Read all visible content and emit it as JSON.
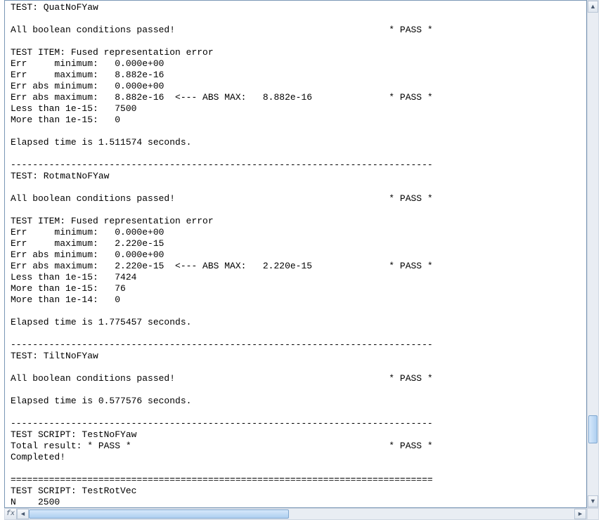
{
  "tests": [
    {
      "name": "QuatNoFYaw",
      "boolean_pass_msg": "All boolean conditions passed!",
      "boolean_pass_tag": "* PASS *",
      "item": {
        "title": "Fused representation error",
        "metrics": [
          {
            "label": "Err     minimum:",
            "value": "0.000e+00"
          },
          {
            "label": "Err     maximum:",
            "value": "8.882e-16"
          },
          {
            "label": "Err abs minimum:",
            "value": "0.000e+00"
          },
          {
            "label": "Err abs maximum:",
            "value": "8.882e-16",
            "absmax_val": "8.882e-16",
            "pass_tag": "* PASS *"
          },
          {
            "label": "Less than 1e-15:",
            "value": "7500"
          },
          {
            "label": "More than 1e-15:",
            "value": "0"
          }
        ]
      },
      "elapsed": "Elapsed time is 1.511574 seconds."
    },
    {
      "name": "RotmatNoFYaw",
      "boolean_pass_msg": "All boolean conditions passed!",
      "boolean_pass_tag": "* PASS *",
      "item": {
        "title": "Fused representation error",
        "metrics": [
          {
            "label": "Err     minimum:",
            "value": "0.000e+00"
          },
          {
            "label": "Err     maximum:",
            "value": "2.220e-15"
          },
          {
            "label": "Err abs minimum:",
            "value": "0.000e+00"
          },
          {
            "label": "Err abs maximum:",
            "value": "2.220e-15",
            "absmax_val": "2.220e-15",
            "pass_tag": "* PASS *"
          },
          {
            "label": "Less than 1e-15:",
            "value": "7424"
          },
          {
            "label": "More than 1e-15:",
            "value": "76"
          },
          {
            "label": "More than 1e-14:",
            "value": "0"
          }
        ]
      },
      "elapsed": "Elapsed time is 1.775457 seconds."
    },
    {
      "name": "TiltNoFYaw",
      "boolean_pass_msg": "All boolean conditions passed!",
      "boolean_pass_tag": "* PASS *",
      "item": null,
      "elapsed": "Elapsed time is 0.577576 seconds."
    }
  ],
  "script_footer": {
    "name": "TestNoFYaw",
    "total_result_label": "Total result:",
    "total_result_value": "* PASS *",
    "total_result_tag": "* PASS *",
    "completed": "Completed!"
  },
  "next_script": {
    "name": "TestRotVec",
    "partial_line_prefix": "N",
    "partial_line_value": "2500"
  },
  "labels": {
    "test_prefix": "TEST:",
    "test_item_prefix": "TEST ITEM:",
    "test_script_prefix": "TEST SCRIPT:",
    "absmax_prefix": "<--- ABS MAX:",
    "separator_dash": "-----------------------------------------------------------------------------",
    "separator_eq": "============================================================================="
  },
  "hscroll_fx_label": "fx"
}
